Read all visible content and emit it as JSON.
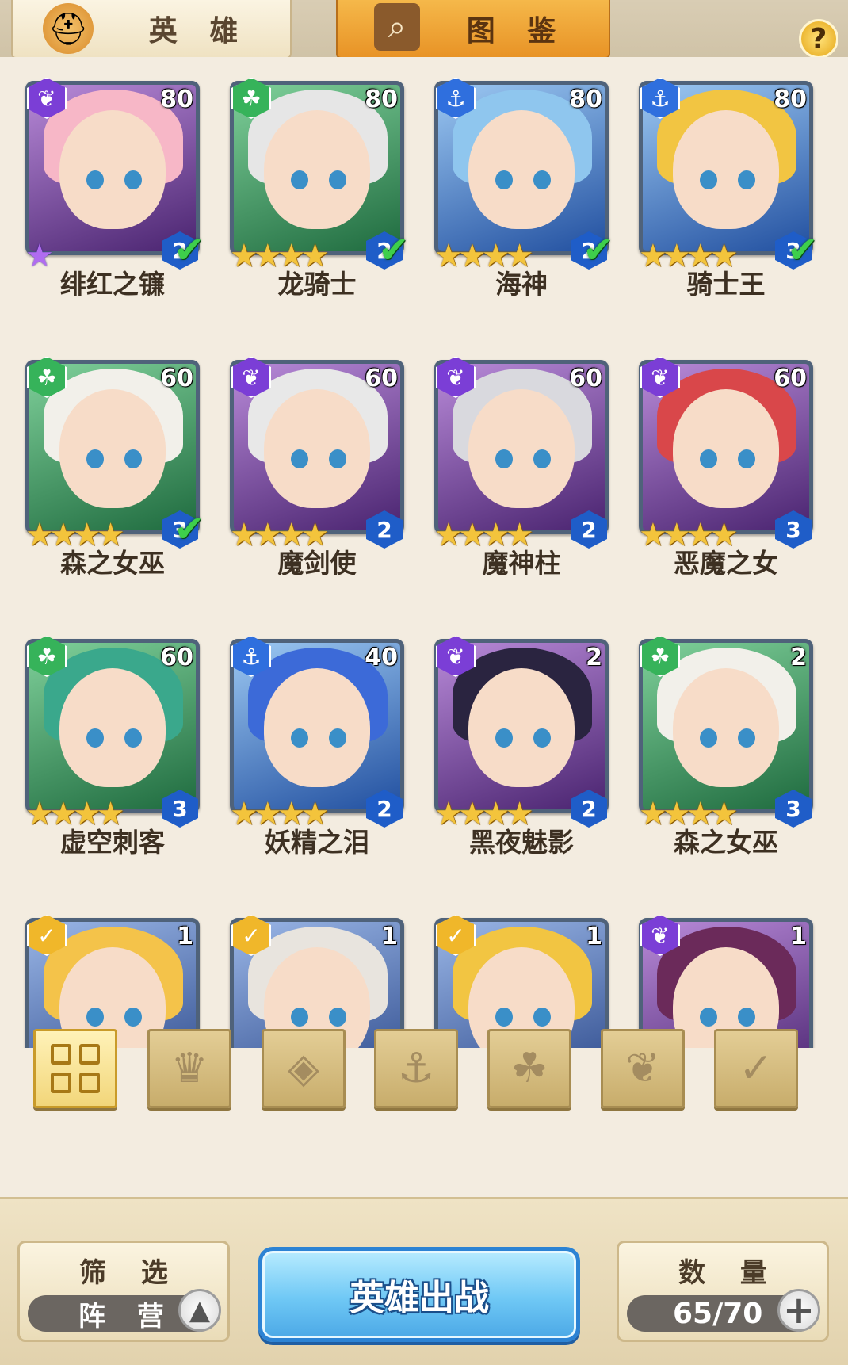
{
  "tabs": [
    {
      "label": "英 雄",
      "icon": "knight-helmet-icon"
    },
    {
      "label": "图 鉴",
      "icon": "magnifier-book-icon"
    }
  ],
  "help_label": "?",
  "heroes": [
    {
      "name": "绯红之镰",
      "level": "80",
      "faction": "purple",
      "stars": "★",
      "rainbow": true,
      "grade": "2",
      "owned_check": true
    },
    {
      "name": "龙骑士",
      "level": "80",
      "faction": "green",
      "stars": "★★★★",
      "rainbow": false,
      "grade": "2",
      "owned_check": true
    },
    {
      "name": "海神",
      "level": "80",
      "faction": "blue",
      "stars": "★★★★",
      "rainbow": false,
      "grade": "2",
      "owned_check": true
    },
    {
      "name": "骑士王",
      "level": "80",
      "faction": "blue",
      "stars": "★★★★",
      "rainbow": false,
      "grade": "3",
      "owned_check": true
    },
    {
      "name": "森之女巫",
      "level": "60",
      "faction": "green",
      "stars": "★★★★",
      "rainbow": false,
      "grade": "3",
      "owned_check": true
    },
    {
      "name": "魔剑使",
      "level": "60",
      "faction": "purple",
      "stars": "★★★★",
      "rainbow": false,
      "grade": "2",
      "owned_check": false
    },
    {
      "name": "魔神柱",
      "level": "60",
      "faction": "purple",
      "stars": "★★★★",
      "rainbow": false,
      "grade": "2",
      "owned_check": false
    },
    {
      "name": "恶魔之女",
      "level": "60",
      "faction": "purple",
      "stars": "★★★★",
      "rainbow": false,
      "grade": "3",
      "owned_check": false
    },
    {
      "name": "虚空刺客",
      "level": "60",
      "faction": "green",
      "stars": "★★★★",
      "rainbow": false,
      "grade": "3",
      "owned_check": false
    },
    {
      "name": "妖精之泪",
      "level": "40",
      "faction": "blue",
      "stars": "★★★★",
      "rainbow": false,
      "grade": "2",
      "owned_check": false
    },
    {
      "name": "黑夜魅影",
      "level": "2",
      "faction": "purple",
      "stars": "★★★★",
      "rainbow": false,
      "grade": "2",
      "owned_check": false
    },
    {
      "name": "森之女巫",
      "level": "2",
      "faction": "green",
      "stars": "★★★★",
      "rainbow": false,
      "grade": "3",
      "owned_check": false
    },
    {
      "name": "",
      "level": "1",
      "faction": "gold",
      "stars": "",
      "rainbow": false,
      "grade": "",
      "owned_check": false
    },
    {
      "name": "",
      "level": "1",
      "faction": "gold",
      "stars": "",
      "rainbow": false,
      "grade": "",
      "owned_check": false
    },
    {
      "name": "",
      "level": "1",
      "faction": "gold",
      "stars": "",
      "rainbow": false,
      "grade": "",
      "owned_check": false
    },
    {
      "name": "",
      "level": "1",
      "faction": "purple",
      "stars": "",
      "rainbow": false,
      "grade": "",
      "owned_check": false
    }
  ],
  "faction_filters": [
    {
      "name": "all-factions-icon",
      "active": true
    },
    {
      "name": "light-faction-icon"
    },
    {
      "name": "diamond-faction-icon"
    },
    {
      "name": "anchor-faction-icon"
    },
    {
      "name": "beast-faction-icon"
    },
    {
      "name": "demon-faction-icon"
    },
    {
      "name": "chevron-faction-icon"
    }
  ],
  "bottom": {
    "filter_title": "筛 选",
    "filter_value": "阵 营",
    "deploy_label": "英雄出战",
    "count_title": "数 量",
    "count_value": "65/70"
  },
  "colors": {
    "purple": "#7b3ed6",
    "green": "#36b35a",
    "blue": "#2f6fde",
    "gold": "#f0b72a"
  }
}
